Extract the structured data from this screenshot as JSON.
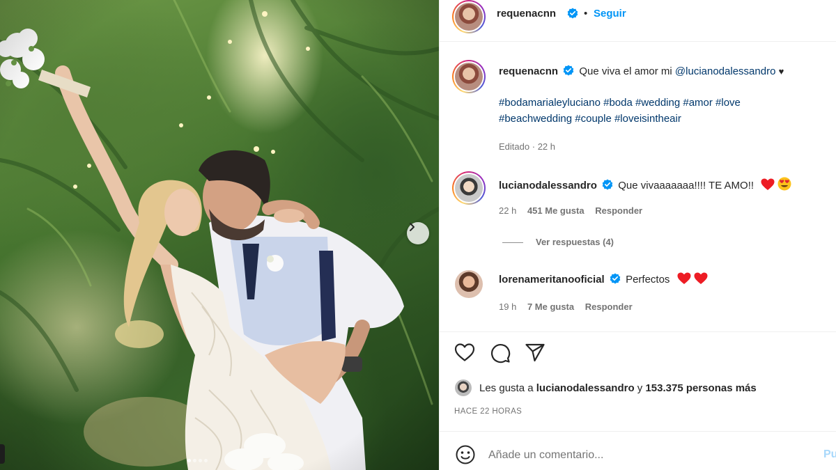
{
  "post": {
    "author": "requenacnn",
    "follow_label": "Seguir",
    "caption_text": "Que viva el amor mi",
    "caption_mention": "@lucianodalessandro",
    "caption_heart": "♥",
    "hashtags_line1": "#bodamarialeyluciano #boda #wedding #amor #love",
    "hashtags_line2": "#beachwedding #couple #loveisintheair",
    "edited": "Editado",
    "edited_dot": "·",
    "edited_time": "22 h"
  },
  "comments": [
    {
      "user": "lucianodalessandro",
      "text": "Que vivaaaaaaa!!!! TE AMO!!",
      "time": "22 h",
      "likes": "451 Me gusta",
      "reply": "Responder",
      "view_replies": "Ver respuestas (4)"
    },
    {
      "user": "lorenameritanooficial",
      "text": "Perfectos",
      "time": "19 h",
      "likes": "7 Me gusta",
      "reply": "Responder"
    }
  ],
  "likes_summary": {
    "prefix": "Les gusta a",
    "user": "lucianodalessandro",
    "joiner": "y",
    "others": "153.375 personas más"
  },
  "timestamp": "HACE 22 HORAS",
  "comment_box": {
    "placeholder": "Añade un comentario...",
    "publish": "Pu"
  },
  "carousel": {
    "total_slides": 4,
    "active_slide": 1
  },
  "colors": {
    "link": "#00376b",
    "accent": "#0095f6",
    "verified": "#0095f6",
    "heart": "#ed1c24"
  },
  "icons": [
    "like-icon",
    "comment-icon",
    "share-icon",
    "emoji-icon",
    "verified-icon",
    "chevron-right-icon"
  ]
}
